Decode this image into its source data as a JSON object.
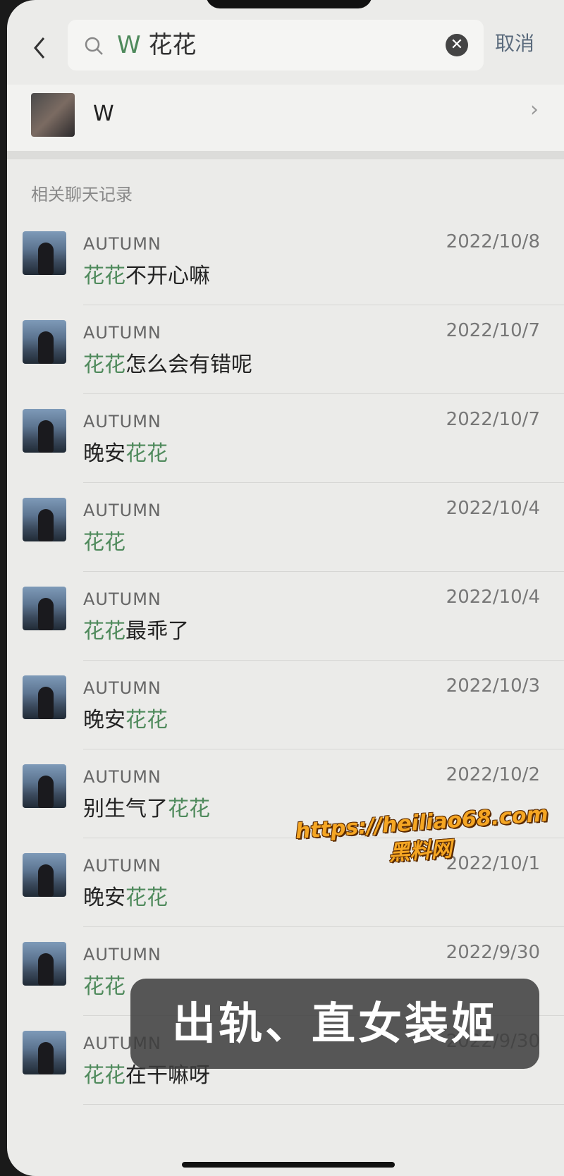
{
  "search": {
    "query_prefix": "W ",
    "query_highlight": "花花",
    "cancel_label": "取消"
  },
  "contact": {
    "name": "W"
  },
  "section_title": "相关聊天记录",
  "chats": [
    {
      "name": "AUTUMN",
      "date": "2022/10/8",
      "pre": "",
      "hl": "花花",
      "post": "不开心嘛"
    },
    {
      "name": "AUTUMN",
      "date": "2022/10/7",
      "pre": "",
      "hl": "花花",
      "post": "怎么会有错呢"
    },
    {
      "name": "AUTUMN",
      "date": "2022/10/7",
      "pre": "晚安",
      "hl": "花花",
      "post": ""
    },
    {
      "name": "AUTUMN",
      "date": "2022/10/4",
      "pre": "",
      "hl": "花花",
      "post": ""
    },
    {
      "name": "AUTUMN",
      "date": "2022/10/4",
      "pre": "",
      "hl": "花花",
      "post": "最乖了"
    },
    {
      "name": "AUTUMN",
      "date": "2022/10/3",
      "pre": "晚安",
      "hl": "花花",
      "post": ""
    },
    {
      "name": "AUTUMN",
      "date": "2022/10/2",
      "pre": "别生气了",
      "hl": "花花",
      "post": ""
    },
    {
      "name": "AUTUMN",
      "date": "2022/10/1",
      "pre": "晚安",
      "hl": "花花",
      "post": ""
    },
    {
      "name": "AUTUMN",
      "date": "2022/9/30",
      "pre": "",
      "hl": "花花",
      "post": ""
    },
    {
      "name": "AUTUMN",
      "date": "2022/9/30",
      "pre": "",
      "hl": "花花",
      "post": "在干嘛呀"
    }
  ],
  "watermark": {
    "url": "https://heiliao68.com",
    "site": "黑料网"
  },
  "caption": "出轨、直女装姬",
  "colors": {
    "highlight": "#4f8a5c",
    "watermark": "#f5a623"
  }
}
